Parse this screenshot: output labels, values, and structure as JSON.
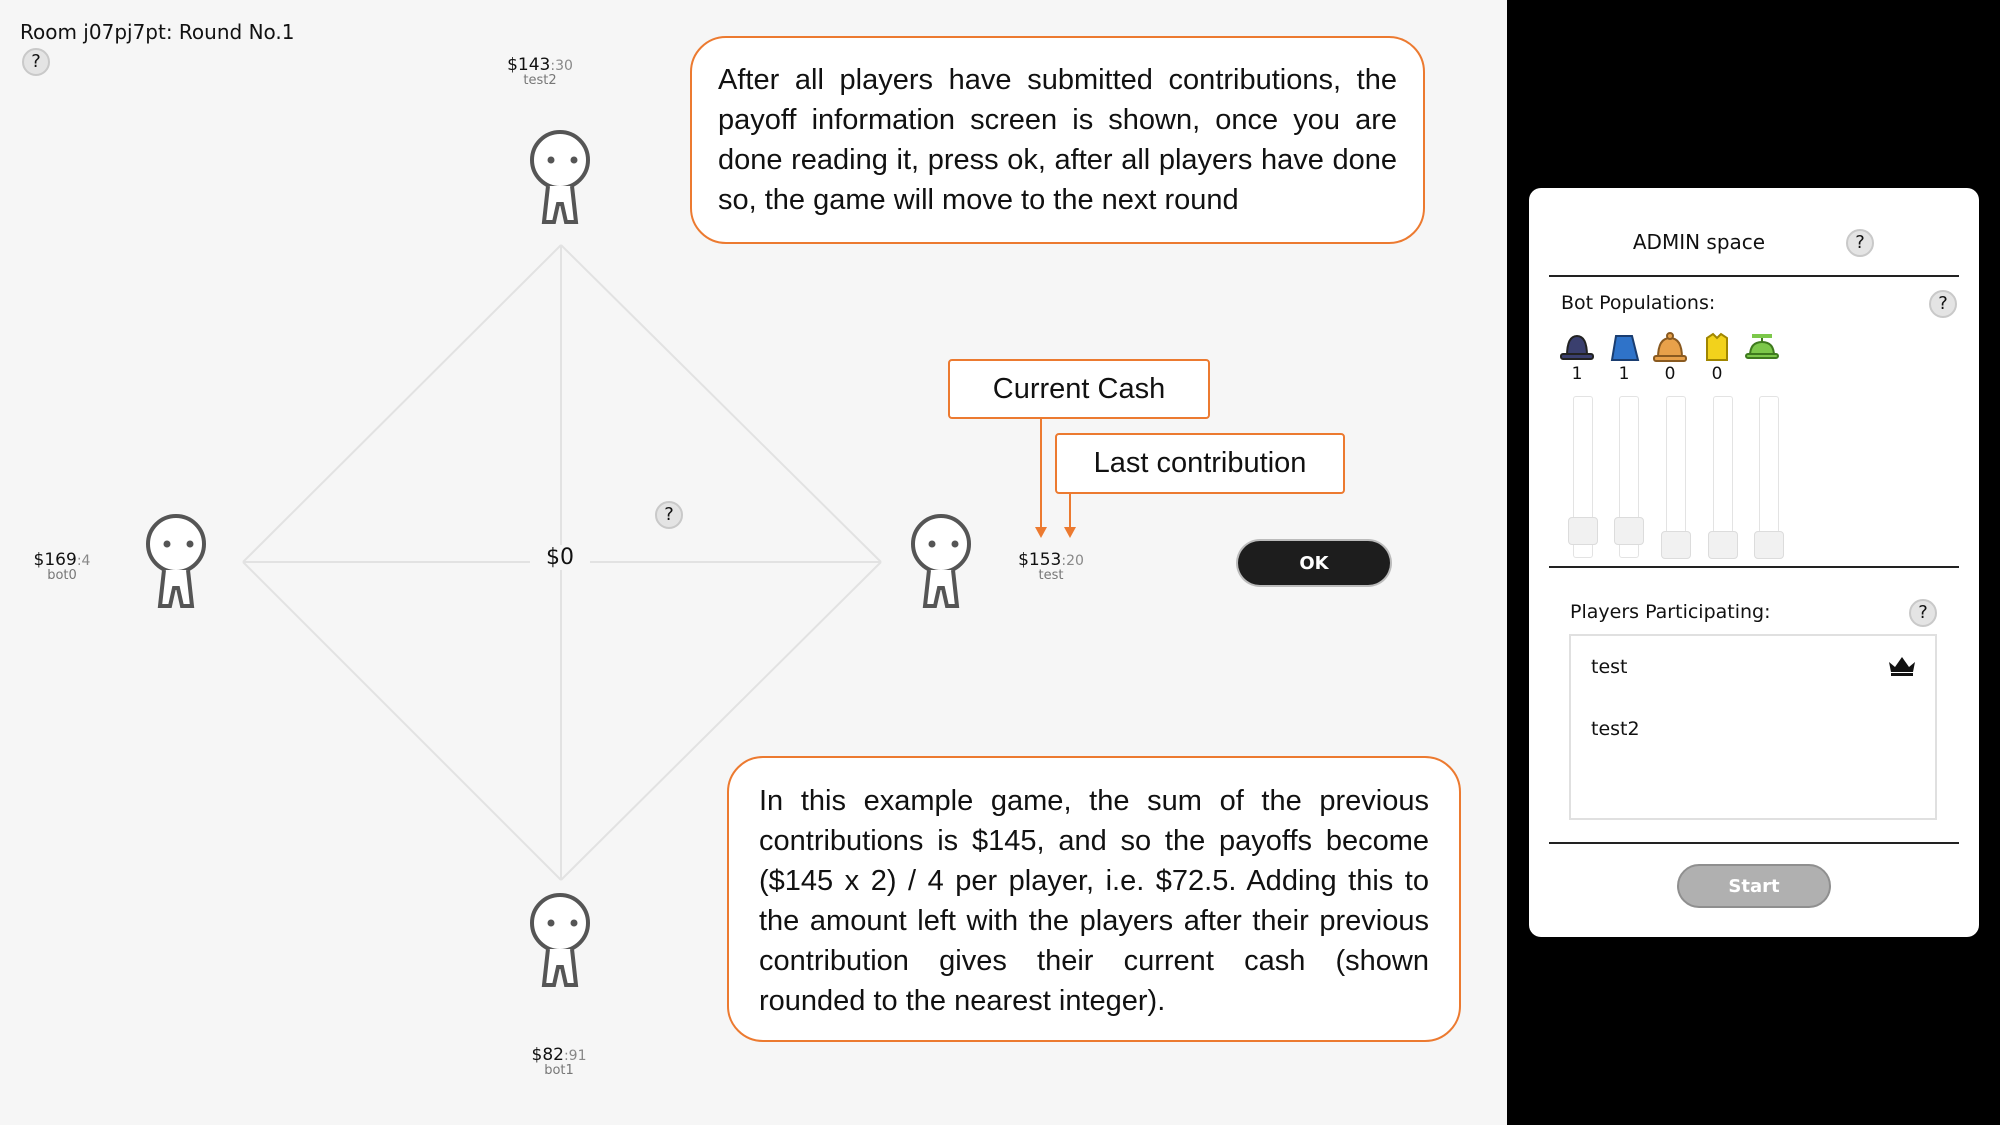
{
  "room_title": "Room j07pj7pt: Round No.1",
  "help_label": "?",
  "center_pot": "$0",
  "players": {
    "top": {
      "cash": "$143",
      "contrib": ":30",
      "name": "test2"
    },
    "left": {
      "cash": "$169",
      "contrib": ":4",
      "name": "bot0"
    },
    "right": {
      "cash": "$153",
      "contrib": ":20",
      "name": "test"
    },
    "bottom": {
      "cash": "$82",
      "contrib": ":91",
      "name": "bot1"
    }
  },
  "ok_label": "OK",
  "callouts": {
    "top": "After all players have submitted contributions, the payoff information screen is shown, once you are done reading it, press ok, after all players have done so, the game will move to the next round",
    "current_cash": "Current Cash",
    "last_contribution": "Last contribution",
    "bottom": "In this example game, the sum of the previous contributions is $145, and so the payoffs become ($145 x 2) / 4 per player, i.e. $72.5. Adding this to the amount left with the players after their previous contribution gives their current cash (shown rounded to the nearest integer)."
  },
  "admin": {
    "title": "ADMIN space",
    "bot_populations_label": "Bot Populations:",
    "bots": [
      {
        "icon": "bowler-hat-icon",
        "color": "#3a3f6e",
        "count": "1",
        "level": 0.1
      },
      {
        "icon": "blue-fez-icon",
        "color": "#2f73c9",
        "count": "1",
        "level": 0.1
      },
      {
        "icon": "deerstalker-hat-icon",
        "color": "#e8a14a",
        "count": "0",
        "level": 0
      },
      {
        "icon": "yellow-hat-icon",
        "color": "#f2d21c",
        "count": "0",
        "level": 0
      },
      {
        "icon": "propeller-cap-icon",
        "color": "#7cc84a",
        "count": "",
        "level": 0
      }
    ],
    "players_label": "Players Participating:",
    "players": [
      "test",
      "test2"
    ],
    "start_label": "Start"
  },
  "colors": {
    "accent_orange": "#ec7a30",
    "ok_button": "#1d1d1d",
    "start_button": "#b0b0b0"
  }
}
